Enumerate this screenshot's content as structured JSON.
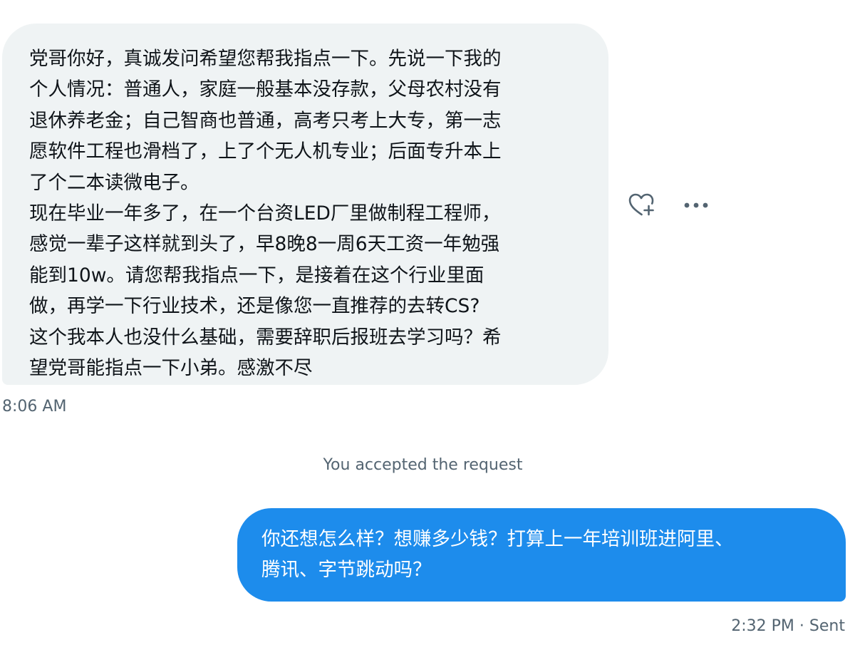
{
  "conversation": {
    "incoming_message": {
      "lines": [
        "党哥你好，真诚发问希望您帮我指点一下。先说一下我的",
        "个人情况：普通人，家庭一般基本没存款，父母农村没有",
        "退休养老金；自己智商也普通，高考只考上大专，第一志",
        "愿软件工程也滑档了，上了个无人机专业；后面专升本上",
        "了个二本读微电子。",
        "现在毕业一年多了，在一个台资LED厂里做制程工程师，",
        "感觉一辈子这样就到头了，早8晚8一周6天工资一年勉强",
        "能到10w。请您帮我指点一下，是接着在这个行业里面",
        "做，再学一下行业技术，还是像您一直推荐的去转CS?",
        "这个我本人也没什么基础，需要辞职后报班去学习吗？希",
        "望党哥能指点一下小弟。感激不尽"
      ],
      "time": "8:06 AM",
      "actions": [
        {
          "name": "react",
          "icon": "heart-plus-icon"
        },
        {
          "name": "more",
          "icon": "more-horizontal-icon"
        }
      ]
    },
    "system_note": "You accepted the request",
    "outgoing_message": {
      "lines": [
        "你还想怎么样？想赚多少钱？打算上一年培训班进阿里、",
        "腾讯、字节跳动吗？"
      ],
      "time": "2:32 PM",
      "status": "Sent",
      "separator": "·"
    }
  },
  "colors": {
    "incoming_bubble": "#eff3f4",
    "outgoing_bubble": "#1d8cec",
    "primary_text": "#0f1419",
    "secondary_text": "#536471",
    "outgoing_text": "#ffffff"
  }
}
